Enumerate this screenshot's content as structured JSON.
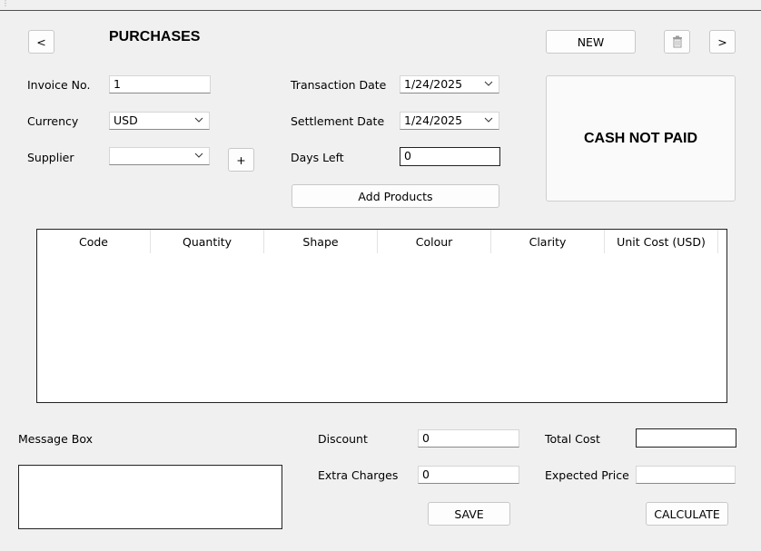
{
  "title": "PURCHASES",
  "nav": {
    "prev": "<",
    "next": ">",
    "new": "NEW"
  },
  "form": {
    "invoice_label": "Invoice No.",
    "invoice_value": "1",
    "currency_label": "Currency",
    "currency_value": "USD",
    "supplier_label": "Supplier",
    "supplier_value": "",
    "add_supplier": "+",
    "transaction_date_label": "Transaction Date",
    "transaction_date_value": "1/24/2025",
    "settlement_date_label": "Settlement Date",
    "settlement_date_value": "1/24/2025",
    "days_left_label": "Days Left",
    "days_left_value": "0",
    "add_products": "Add Products"
  },
  "status": "CASH NOT PAID",
  "table": {
    "columns": [
      "Code",
      "Quantity",
      "Shape",
      "Colour",
      "Clarity",
      "Unit Cost (USD)"
    ],
    "rows": []
  },
  "footer": {
    "message_label": "Message Box",
    "discount_label": "Discount",
    "discount_value": "0",
    "extra_label": "Extra Charges",
    "extra_value": "0",
    "total_label": "Total Cost",
    "total_value": "",
    "expected_label": "Expected Price",
    "expected_value": "",
    "save": "SAVE",
    "calculate": "CALCULATE"
  }
}
